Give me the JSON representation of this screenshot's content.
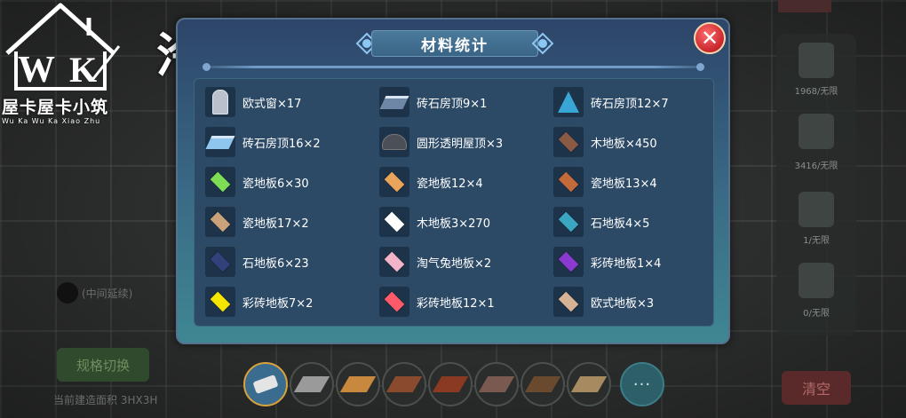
{
  "watermark": {
    "logo_letters": "W K",
    "brand_cn": "屋卡屋卡小筑",
    "brand_pinyin": "Wu  Ka  Wu  Ka  Xiao  Zhu",
    "author": "泠鸢"
  },
  "modal": {
    "title": "材料统计",
    "close_symbol": "✕",
    "items": [
      {
        "label": "欧式窗×17",
        "icon": "window-icon",
        "color": "#b9c2cc"
      },
      {
        "label": "砖石房顶9×1",
        "icon": "roof-slab-icon",
        "color": "#6f87a6"
      },
      {
        "label": "砖石房顶12×7",
        "icon": "cone-roof-icon",
        "color": "#3aa6d8"
      },
      {
        "label": "砖石房顶16×2",
        "icon": "roof-slope-icon",
        "color": "#8fc6ee"
      },
      {
        "label": "圆形透明屋顶×3",
        "icon": "dome-icon",
        "color": "#4a4f58"
      },
      {
        "label": "木地板×450",
        "icon": "wood-floor-icon",
        "color": "#8a5a44"
      },
      {
        "label": "瓷地板6×30",
        "icon": "tile-icon",
        "color": "#7fdc55"
      },
      {
        "label": "瓷地板12×4",
        "icon": "tile-icon",
        "color": "#e8a45a"
      },
      {
        "label": "瓷地板13×4",
        "icon": "tile-icon",
        "color": "#c36a3a"
      },
      {
        "label": "瓷地板17×2",
        "icon": "tile-icon",
        "color": "#caa27a"
      },
      {
        "label": "木地板3×270",
        "icon": "tile-icon",
        "color": "#ffffff"
      },
      {
        "label": "石地板4×5",
        "icon": "tile-icon",
        "color": "#3aa6c2"
      },
      {
        "label": "石地板6×23",
        "icon": "tile-icon",
        "color": "#33417a"
      },
      {
        "label": "淘气兔地板×2",
        "icon": "tile-icon",
        "color": "#f2b4c8"
      },
      {
        "label": "彩砖地板1×4",
        "icon": "tile-icon",
        "color": "#8a3ad0"
      },
      {
        "label": "彩砖地板7×2",
        "icon": "tile-icon",
        "color": "#f4e600"
      },
      {
        "label": "彩砖地板12×1",
        "icon": "tile-icon",
        "color": "#ff5a6a"
      },
      {
        "label": "欧式地板×3",
        "icon": "tile-icon",
        "color": "#d8b294"
      }
    ]
  },
  "side_panel": {
    "stats": [
      "1968/无限",
      "3416/无限",
      "1/无限",
      "0/无限"
    ]
  },
  "buttons": {
    "clear": "清空",
    "spec_switch": "规格切换",
    "more": "···"
  },
  "left_info": {
    "middle_label": "(中间延续)",
    "area": "当前建造面积 3HX3H"
  },
  "toolbar": {
    "slots": [
      {
        "name": "eraser",
        "color": "#d8d8d8"
      },
      {
        "name": "grey-tile",
        "color": "#9a9a9a"
      },
      {
        "name": "orange-tile",
        "color": "#c8883e"
      },
      {
        "name": "brown-tile",
        "color": "#8a4a2e"
      },
      {
        "name": "red-brown-tile",
        "color": "#8a3a22"
      },
      {
        "name": "pattern-tile",
        "color": "#7a5a50"
      },
      {
        "name": "dark-pattern-tile",
        "color": "#6a4a2e"
      },
      {
        "name": "beige-pattern-tile",
        "color": "#a88a60"
      }
    ]
  }
}
